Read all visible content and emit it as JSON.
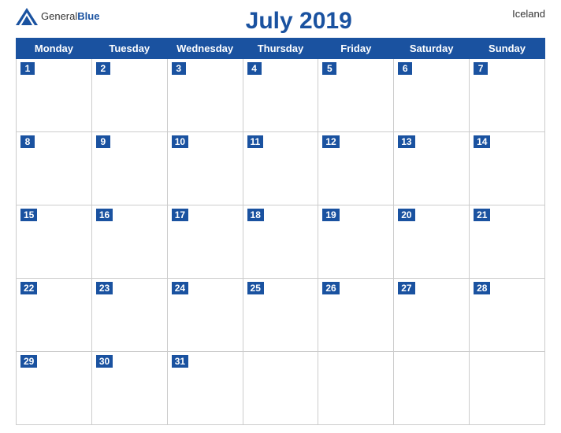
{
  "header": {
    "logo": {
      "general": "General",
      "blue": "Blue",
      "icon": "▶"
    },
    "title": "July 2019",
    "country": "Iceland"
  },
  "weekdays": [
    "Monday",
    "Tuesday",
    "Wednesday",
    "Thursday",
    "Friday",
    "Saturday",
    "Sunday"
  ],
  "weeks": [
    [
      1,
      2,
      3,
      4,
      5,
      6,
      7
    ],
    [
      8,
      9,
      10,
      11,
      12,
      13,
      14
    ],
    [
      15,
      16,
      17,
      18,
      19,
      20,
      21
    ],
    [
      22,
      23,
      24,
      25,
      26,
      27,
      28
    ],
    [
      29,
      30,
      31,
      null,
      null,
      null,
      null
    ]
  ]
}
